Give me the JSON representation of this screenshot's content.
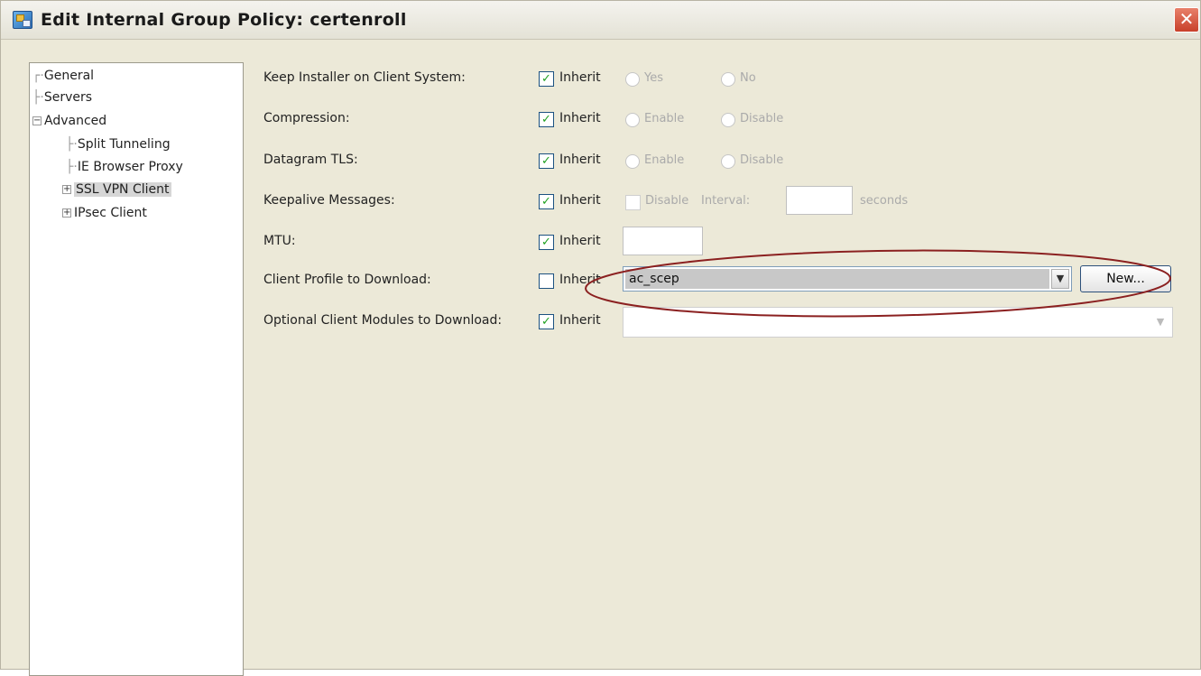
{
  "window": {
    "title": "Edit Internal Group Policy: certenroll",
    "close_glyph": "✕"
  },
  "tree": {
    "items": [
      {
        "label": "General"
      },
      {
        "label": "Servers"
      },
      {
        "label": "Advanced"
      },
      {
        "label": "Split Tunneling"
      },
      {
        "label": "IE Browser Proxy"
      },
      {
        "label": "SSL VPN Client"
      },
      {
        "label": "IPsec Client"
      }
    ]
  },
  "form": {
    "rows": [
      {
        "label": "Keep Installer on Client System:",
        "inherit": "Inherit",
        "opt1": "Yes",
        "opt2": "No"
      },
      {
        "label": "Compression:",
        "inherit": "Inherit",
        "opt1": "Enable",
        "opt2": "Disable"
      },
      {
        "label": "Datagram TLS:",
        "inherit": "Inherit",
        "opt1": "Enable",
        "opt2": "Disable"
      },
      {
        "label": "Keepalive Messages:",
        "inherit": "Inherit",
        "disable": "Disable",
        "interval": "Interval:",
        "seconds": "seconds"
      },
      {
        "label": "MTU:",
        "inherit": "Inherit"
      },
      {
        "label": "Client Profile to Download:",
        "inherit": "Inherit",
        "value": "ac_scep",
        "button": "New..."
      },
      {
        "label": "Optional Client Modules to Download:",
        "inherit": "Inherit",
        "value": ""
      }
    ]
  },
  "colors": {
    "highlight_ellipse": "#8b2020",
    "checkmark": "#21a121"
  }
}
